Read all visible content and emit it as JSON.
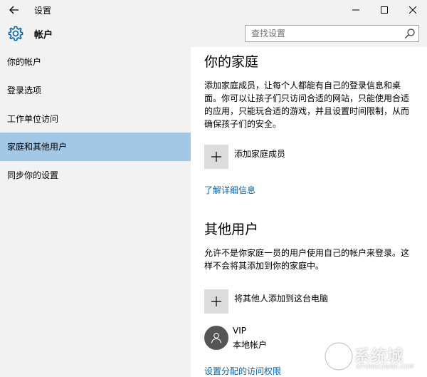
{
  "window": {
    "title": "设置",
    "back_icon": "arrow-left-icon",
    "controls": [
      "minimize-icon",
      "maximize-icon",
      "close-icon"
    ]
  },
  "header": {
    "icon": "gear-icon",
    "title": "帐户",
    "search_placeholder": "查找设置"
  },
  "sidebar": {
    "items": [
      {
        "label": "你的帐户",
        "selected": false
      },
      {
        "label": "登录选项",
        "selected": false
      },
      {
        "label": "工作单位访问",
        "selected": false
      },
      {
        "label": "家庭和其他用户",
        "selected": true
      },
      {
        "label": "同步你的设置",
        "selected": false
      }
    ]
  },
  "family": {
    "heading": "你的家庭",
    "description": "添加家庭成员，让每个人都能有自己的登录信息和桌面。你可以让孩子们只访问合适的网站，只能使用合适的应用，只能玩合适的游戏，并且设置时间限制，从而确保孩子们的安全。",
    "add_label": "添加家庭成员",
    "learn_more": "了解详细信息"
  },
  "others": {
    "heading": "其他用户",
    "description": "允许不是你家庭一员的用户使用自己的帐户来登录。这样不会将其添加到你的家庭中。",
    "add_label": "将其他人添加到这台电脑",
    "user": {
      "name": "VIP",
      "type": "本地帐户"
    },
    "assigned_access": "设置分配的访问权限"
  },
  "watermark": {
    "text": "系统城",
    "sub": "XITONGCHENG.COM"
  },
  "colors": {
    "chrome_bg": "#f2f2f2",
    "selected_bg": "#a2c8e6",
    "link": "#0063b1",
    "plus_box": "#dcdcdc",
    "avatar": "#555555"
  }
}
